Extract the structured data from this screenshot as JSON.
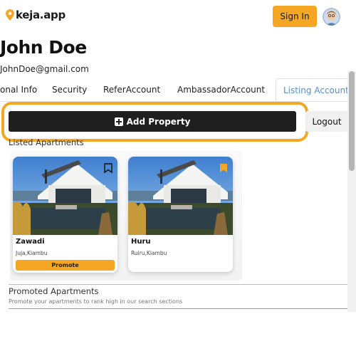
{
  "header": {
    "logo_text": "keja.app",
    "signin_label": "Sign In",
    "brand_color": "#f5a623"
  },
  "profile": {
    "name": "John Doe",
    "email": "JohnDoe@gmail.com"
  },
  "tabs": [
    {
      "label": "onal Info",
      "active": false
    },
    {
      "label": "Security",
      "active": false
    },
    {
      "label": "ReferAccount",
      "active": false
    },
    {
      "label": "AmbassadorAccount",
      "active": false
    },
    {
      "label": "Listing Account",
      "active": true
    }
  ],
  "actions": {
    "add_property_label": "Add Property",
    "logout_label": "Logout"
  },
  "listed": {
    "title": "Listed Apartments",
    "cards": [
      {
        "name": "Zawadi",
        "location": "Juja,Kiambu",
        "promote_label": "Promote",
        "bookmark_icon": "bookmark-outline-icon"
      },
      {
        "name": "Huru",
        "location": "Ruiru,Kiambu",
        "bookmark_icon": "bookmark-filled-icon"
      }
    ]
  },
  "promoted": {
    "title": "Promoted Apartments",
    "subtitle": "Promote your apartments to rank high in our search sections"
  }
}
